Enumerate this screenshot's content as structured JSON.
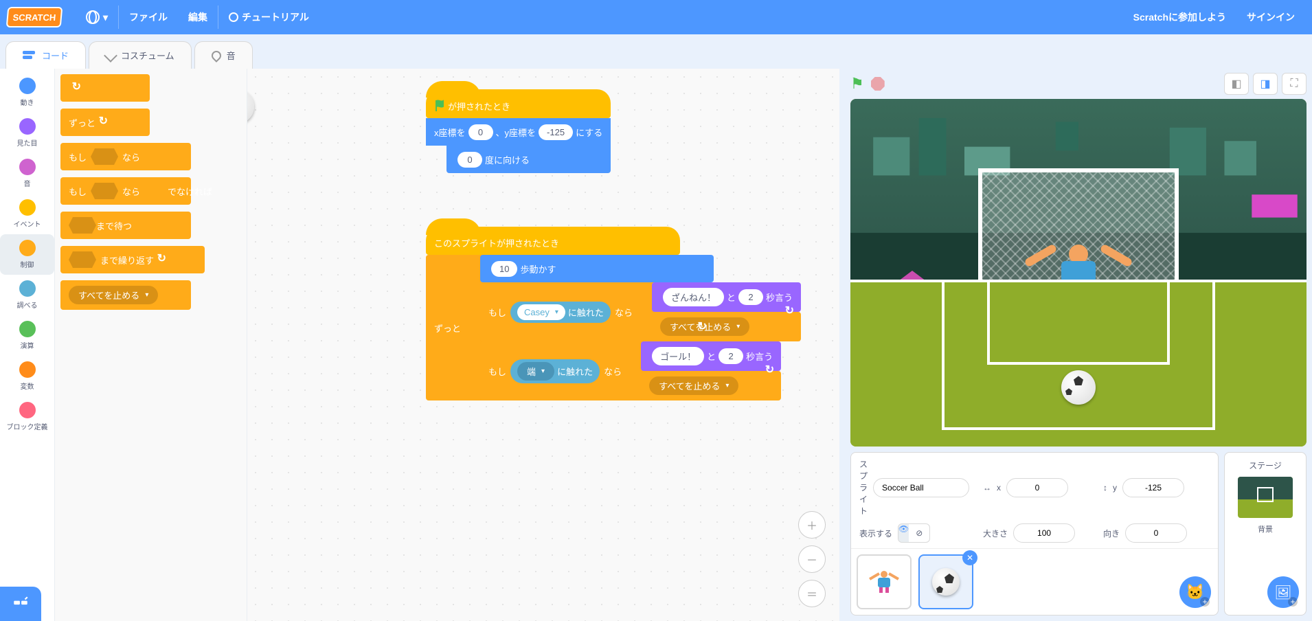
{
  "menu": {
    "logo": "SCRATCH",
    "file": "ファイル",
    "edit": "編集",
    "tutorials": "チュートリアル",
    "join": "Scratchに参加しよう",
    "signin": "サインイン"
  },
  "tabs": {
    "code": "コード",
    "costumes": "コスチューム",
    "sounds": "音"
  },
  "categories": [
    {
      "name": "動き",
      "color": "#4c97ff"
    },
    {
      "name": "見た目",
      "color": "#9966ff"
    },
    {
      "name": "音",
      "color": "#cf63cf"
    },
    {
      "name": "イベント",
      "color": "#ffbf00"
    },
    {
      "name": "制御",
      "color": "#ffab19"
    },
    {
      "name": "調べる",
      "color": "#5cb1d6"
    },
    {
      "name": "演算",
      "color": "#59c059"
    },
    {
      "name": "変数",
      "color": "#ff8c1a"
    },
    {
      "name": "ブロック定義",
      "color": "#ff6680"
    }
  ],
  "palette": {
    "forever": "ずっと",
    "if": "もし",
    "then": "なら",
    "else": "でなければ",
    "wait_until": "まで待つ",
    "repeat_until": "まで繰り返す",
    "stop_all": "すべてを止める"
  },
  "script": {
    "when_flag": "が押されたとき",
    "gotoxy_pre": "x座標を",
    "gotoxy_mid": "、y座標を",
    "gotoxy_post": "にする",
    "goto_x": "0",
    "goto_y": "-125",
    "point_dir_val": "0",
    "point_dir": "度に向ける",
    "when_sprite_clicked": "このスプライトが押されたとき",
    "forever": "ずっと",
    "move_val": "10",
    "move": "歩動かす",
    "if": "もし",
    "then": "なら",
    "touching": "に触れた",
    "casey": "Casey",
    "edge": "端",
    "say_fail": "ざんねん！",
    "say_goal": "ゴール！",
    "say_and": "と",
    "say_secs": "秒言う",
    "say_time1": "2",
    "say_time2": "2",
    "stop_all": "すべてを止める"
  },
  "sprite_info": {
    "label_sprite": "スプライト",
    "name": "Soccer Ball",
    "x_label": "x",
    "x": "0",
    "y_label": "y",
    "y": "-125",
    "show_label": "表示する",
    "size_label": "大きさ",
    "size": "100",
    "direction_label": "向き",
    "direction": "0"
  },
  "stage_sel": {
    "label": "ステージ",
    "backdrop": "背景"
  }
}
